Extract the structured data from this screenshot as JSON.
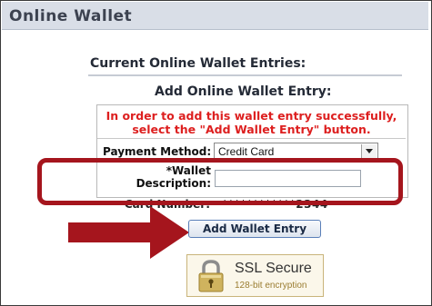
{
  "window": {
    "title": "Online Wallet"
  },
  "current_entries": {
    "title": "Current Online Wallet Entries:"
  },
  "add_entry": {
    "title": "Add Online Wallet Entry:",
    "warning": "In order to add this wallet entry successfully, select the \"Add Wallet Entry\" button.",
    "payment_method": {
      "label": "Payment Method:",
      "value": "Credit Card"
    },
    "wallet_description": {
      "label": "*Wallet Description:",
      "value": ""
    },
    "card_number": {
      "label": "Card Number:",
      "value": "************2344"
    },
    "submit_label": "Add Wallet Entry"
  },
  "ssl": {
    "title": "SSL Secure",
    "subtitle": "128-bit encryption"
  },
  "colors": {
    "highlight": "#a5151d",
    "warning_text": "#dd1f1f"
  }
}
